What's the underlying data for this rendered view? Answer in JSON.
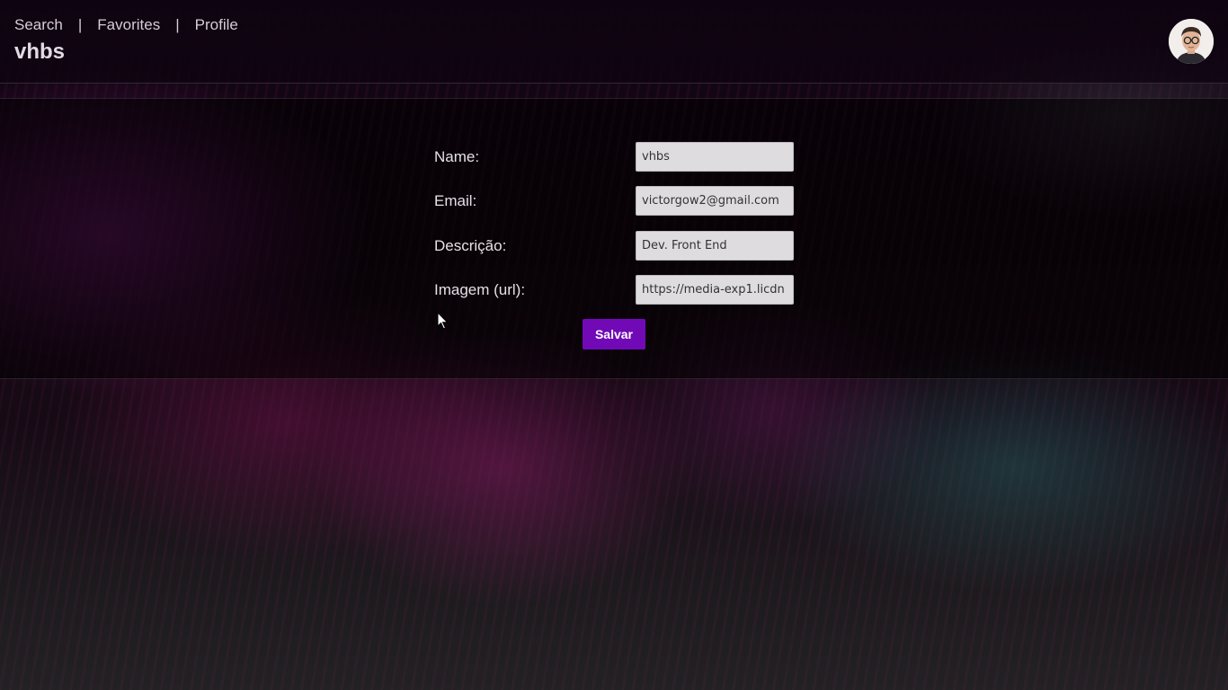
{
  "nav": {
    "items": [
      {
        "label": "Search"
      },
      {
        "label": "Favorites"
      },
      {
        "label": "Profile"
      }
    ],
    "separator": "|"
  },
  "header": {
    "username": "vhbs",
    "avatar_icon": "user-photo-avatar"
  },
  "form": {
    "name": {
      "label": "Name:",
      "value": "vhbs"
    },
    "email": {
      "label": "Email:",
      "value": "victorgow2@gmail.com"
    },
    "description": {
      "label": "Descrição:",
      "value": "Dev. Front End"
    },
    "image": {
      "label": "Imagem (url):",
      "value": "https://media-exp1.licdn"
    },
    "save_label": "Salvar"
  },
  "colors": {
    "accent": "#7209b7",
    "input_bg": "#dedcdf",
    "text": "#e6e0e8"
  }
}
